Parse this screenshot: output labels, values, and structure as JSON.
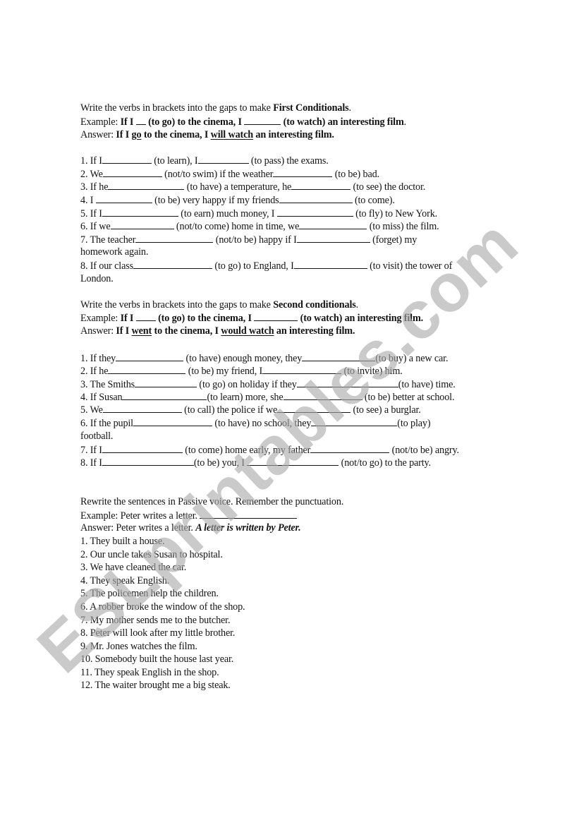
{
  "section1": {
    "instruction_pre": "Write the verbs in brackets into the gaps to make ",
    "instruction_bold": "First Conditionals",
    "instruction_post": ".",
    "example_label": "Example: ",
    "example_a": "If I ",
    "example_b": " (to go) to the cinema, I ",
    "example_c": " (to watch) an interesting film",
    "example_end": ".",
    "answer_label": "Answer: ",
    "answer_a": "If I ",
    "answer_u1": "go",
    "answer_b": " to the cinema, I ",
    "answer_u2": "will watch",
    "answer_c": " an interesting film.",
    "items": [
      {
        "a": "1. If I",
        "b": " (to learn), I",
        "c": " (to pass) the exams."
      },
      {
        "a": "2. We",
        "b": " (not/to swim) if the weather",
        "c": " (to be) bad."
      },
      {
        "a": "3. If he",
        "b": " (to have) a temperature, he",
        "c": " (to see) the doctor."
      },
      {
        "a": "4. I ",
        "b": " (to be) very happy if my friends",
        "c": " (to come)."
      },
      {
        "a": "5. If I",
        "b": " (to earn) much money, I ",
        "c": " (to fly) to New York."
      },
      {
        "a": "6. If we",
        "b": " (not/to come) home in time, we",
        "c": " (to miss) the film."
      },
      {
        "a": "7. The teacher",
        "b": " (not/to be) happy if I",
        "c": " (forget) my"
      },
      {
        "text": "homework again."
      },
      {
        "a": "8. If our class",
        "b": " (to go) to England, I",
        "c": " (to visit) the tower of"
      },
      {
        "text": "London."
      }
    ]
  },
  "section2": {
    "instruction_pre": "Write the verbs in brackets into the gaps to make ",
    "instruction_bold": "Second conditionals",
    "instruction_post": ".",
    "example_label": "Example: ",
    "example_a": "If I ",
    "example_b": " (to go) to the cinema, I ",
    "example_c": " (to watch) an interesting film.",
    "answer_label": "Answer: ",
    "answer_a": "If I ",
    "answer_u1": "went",
    "answer_b": " to the cinema, I ",
    "answer_u2": "would watch",
    "answer_c": " an interesting film.",
    "items": [
      {
        "a": "1. If they",
        "b": " (to have) enough money, they",
        "c": "(to buy) a new car."
      },
      {
        "a": "2. If he",
        "b": " (to be) my friend, I",
        "c": " (to invite) him."
      },
      {
        "a": "3. The Smiths",
        "b": " (to go) on holiday if they",
        "c": "(to have) time."
      },
      {
        "a": "4. If Susan",
        "b": "(to learn) more, she",
        "c": " (to be) better at school."
      },
      {
        "a": "5. We",
        "b": " (to call) the police if we",
        "c": " (to see) a burglar."
      },
      {
        "a": "6. If the pupil",
        "b": " (to have) no school, they",
        "c": "(to play)"
      },
      {
        "text": "football."
      },
      {
        "a": "7. If I",
        "b": " (to come) home early, my father",
        "c": " (not/to be) angry."
      },
      {
        "a": "8. If I",
        "b": "(to be) you, I ",
        "c": " (not/to go) to the party."
      }
    ]
  },
  "section3": {
    "instruction": "Rewrite the sentences in Passive voice. Remember the punctuation.",
    "example_label": "Example: ",
    "example_text": "Peter writes a letter. ",
    "answer_label": "Answer: ",
    "answer_text": "Peter writes a letter. ",
    "answer_bold_italic": "A letter is written by Peter.",
    "items": [
      "1. They built a house.",
      "2. Our uncle takes Susan to hospital.",
      "3. We have cleaned the car.",
      "4. They speak English.",
      "5. The policemen help the children.",
      "6. A robber broke the window of the shop.",
      "7. My mother sends me to the butcher.",
      "8. Peter will look after my little brother.",
      "9. Mr. Jones watches the film.",
      "10. Somebody built the house last year.",
      "11. They speak English in the shop.",
      "12. The waiter brought me a big steak."
    ]
  },
  "watermark": {
    "text": "ESLprintables.com"
  }
}
